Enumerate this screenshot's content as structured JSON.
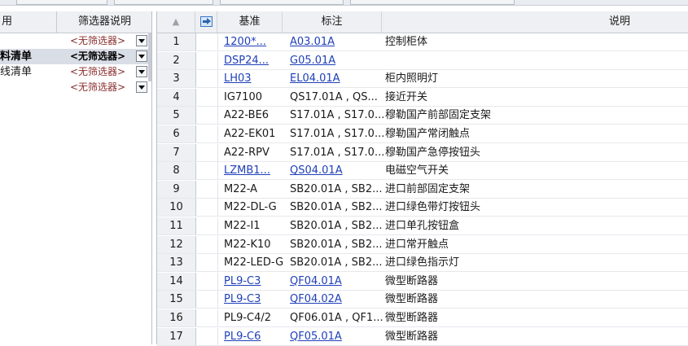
{
  "left_panel": {
    "headers": {
      "name": "用",
      "filter_desc": "筛选器说明"
    },
    "rows": [
      {
        "name": "",
        "filter": "<无筛选器>",
        "selected": false,
        "bold": false
      },
      {
        "name": "料清单",
        "filter": "<无筛选器>",
        "selected": true,
        "bold": true
      },
      {
        "name": "线清单",
        "filter": "<无筛选器>",
        "selected": false,
        "bold": false
      },
      {
        "name": "",
        "filter": "<无筛选器>",
        "selected": false,
        "bold": false
      }
    ]
  },
  "grid": {
    "headers": {
      "base": "基准",
      "mark": "标注",
      "desc": "说明"
    },
    "nav_icon": "navigate-arrow-icon",
    "sort_indicator": "▲",
    "rows": [
      {
        "n": "1",
        "base": "1200*...",
        "mark": "A03.01A",
        "desc": "控制柜体",
        "link": true
      },
      {
        "n": "2",
        "base": "DSP24...",
        "mark": "G05.01A",
        "desc": "",
        "link": true
      },
      {
        "n": "3",
        "base": "LH03",
        "mark": "EL04.01A",
        "desc": "柜内照明灯",
        "link": true
      },
      {
        "n": "4",
        "base": "IG7100",
        "mark": "QS17.01A , QS...",
        "desc": "接近开关",
        "link": false
      },
      {
        "n": "5",
        "base": "A22-BE6",
        "mark": "S17.01A , S17.0...",
        "desc": "穆勒国产前部固定支架",
        "link": false
      },
      {
        "n": "6",
        "base": "A22-EK01",
        "mark": "S17.01A , S17.0...",
        "desc": "穆勒国产常闭触点",
        "link": false
      },
      {
        "n": "7",
        "base": "A22-RPV",
        "mark": "S17.01A , S17.0...",
        "desc": "穆勒国产急停按钮头",
        "link": false
      },
      {
        "n": "8",
        "base": "LZMB1...",
        "mark": "QS04.01A",
        "desc": "电磁空气开关",
        "link": true
      },
      {
        "n": "9",
        "base": "M22-A",
        "mark": "SB20.01A , SB2...",
        "desc": "进口前部固定支架",
        "link": false
      },
      {
        "n": "10",
        "base": "M22-DL-G",
        "mark": "SB20.01A , SB2...",
        "desc": "进口绿色带灯按钮头",
        "link": false
      },
      {
        "n": "11",
        "base": "M22-I1",
        "mark": "SB20.01A , SB2...",
        "desc": "进口单孔按钮盒",
        "link": false
      },
      {
        "n": "12",
        "base": "M22-K10",
        "mark": "SB20.01A , SB2...",
        "desc": "进口常开触点",
        "link": false
      },
      {
        "n": "13",
        "base": "M22-LED-G",
        "mark": "SB20.01A , SB2...",
        "desc": "进口绿色指示灯",
        "link": false
      },
      {
        "n": "14",
        "base": "PL9-C3",
        "mark": "QF04.01A",
        "desc": "微型断路器",
        "link": true
      },
      {
        "n": "15",
        "base": "PL9-C3",
        "mark": "QF04.02A",
        "desc": "微型断路器",
        "link": true
      },
      {
        "n": "16",
        "base": "PL9-C4/2",
        "mark": "QF06.01A , QF1...",
        "desc": "微型断路器",
        "link": false
      },
      {
        "n": "17",
        "base": "PL9-C6",
        "mark": "QF05.01A",
        "desc": "微型断路器",
        "link": true
      }
    ]
  }
}
